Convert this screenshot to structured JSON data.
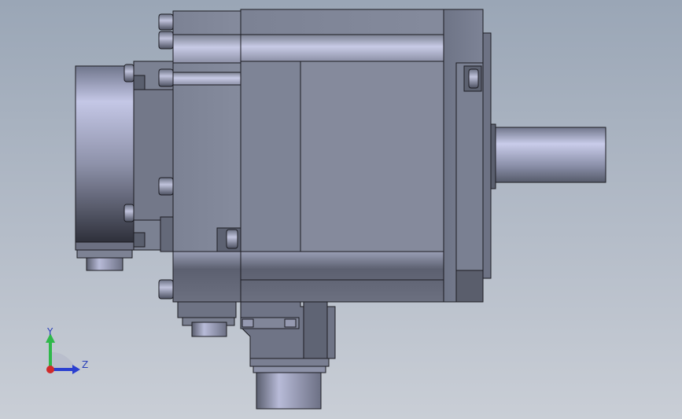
{
  "viewport": {
    "background_top": "#9aa6b6",
    "background_bottom": "#c9ced6",
    "model_edge_color": "#1c1c22"
  },
  "triad": {
    "y_label": "Y",
    "z_label": "Z",
    "y_color": "#2fb84a",
    "z_color": "#2a3fd0",
    "x_color": "#d02a2a"
  }
}
